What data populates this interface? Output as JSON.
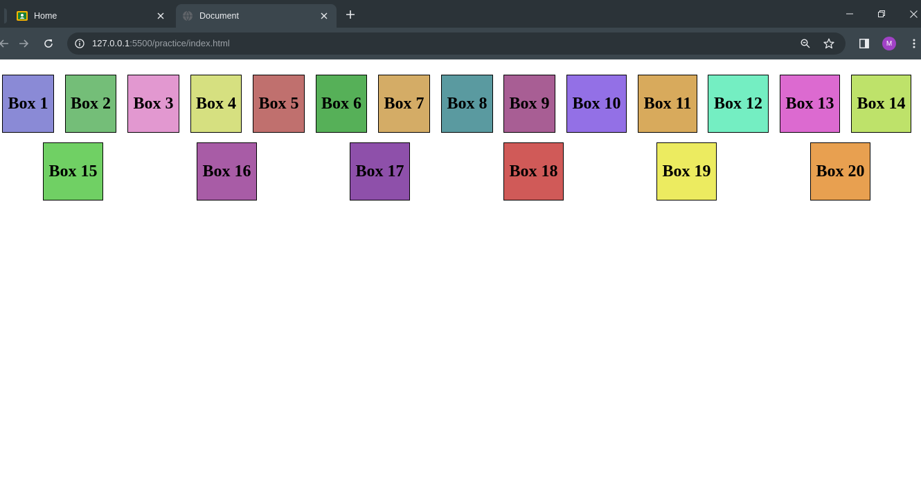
{
  "browser": {
    "tabs": [
      {
        "title": "Home",
        "favicon": "classroom-icon",
        "active": false
      },
      {
        "title": "Document",
        "favicon": "globe-icon",
        "active": true
      }
    ],
    "address": {
      "host": "127.0.0.1",
      "path": ":5500/practice/index.html"
    },
    "profile_initial": "M",
    "colors": {
      "titlebar": "#2b3338",
      "toolbar": "#3b464d",
      "avatar": "#a142c6"
    }
  },
  "page": {
    "boxes": [
      {
        "label": "Box 1",
        "color": "#8a8ad6"
      },
      {
        "label": "Box 2",
        "color": "#74be78"
      },
      {
        "label": "Box 3",
        "color": "#e298d0"
      },
      {
        "label": "Box 4",
        "color": "#d6e080"
      },
      {
        "label": "Box 5",
        "color": "#c0706e"
      },
      {
        "label": "Box 6",
        "color": "#56b058"
      },
      {
        "label": "Box 7",
        "color": "#d4ac66"
      },
      {
        "label": "Box 8",
        "color": "#5a9aa0"
      },
      {
        "label": "Box 9",
        "color": "#a85e94"
      },
      {
        "label": "Box 10",
        "color": "#9370e6"
      },
      {
        "label": "Box 11",
        "color": "#d8aa5c"
      },
      {
        "label": "Box 12",
        "color": "#74eec2"
      },
      {
        "label": "Box 13",
        "color": "#dc6ad0"
      },
      {
        "label": "Box 14",
        "color": "#bee26a"
      },
      {
        "label": "Box 15",
        "color": "#70d064"
      },
      {
        "label": "Box 16",
        "color": "#a85ca6"
      },
      {
        "label": "Box 17",
        "color": "#8e50aa"
      },
      {
        "label": "Box 18",
        "color": "#d05a58"
      },
      {
        "label": "Box 19",
        "color": "#eceb60"
      },
      {
        "label": "Box 20",
        "color": "#e8a050"
      }
    ]
  }
}
